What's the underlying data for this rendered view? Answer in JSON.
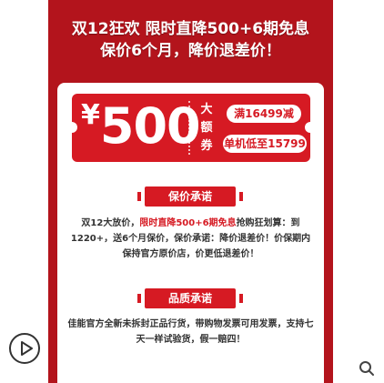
{
  "headline": {
    "line1": "双12狂欢 限时直降500+6期免息",
    "line2": "保价6个月，降价退差价！"
  },
  "coupon": {
    "currency": "¥",
    "amount": "500",
    "vertical_label": [
      "大",
      "额",
      "券"
    ],
    "condition": "满16499减",
    "low_price": "单机低至15799"
  },
  "section1": {
    "title": "保价承诺",
    "text_prefix": "双12大放价，",
    "text_highlight": "限时直降500+6期免息",
    "text_rest": "抢购狂划算：到1220+，送6个月保价，保价承诺：降价退差价！价保期内保持官方原价店，价更低退差价！"
  },
  "section2": {
    "title": "品质承诺",
    "text": "佳能官方全新未拆封正品行货，带购物发票可用发票，支持七天一样试验货，假一赔四！"
  },
  "icons": {
    "play": "play-icon",
    "search": "search-icon"
  },
  "colors": {
    "banner": "#b3141c",
    "accent": "#d61a23"
  }
}
